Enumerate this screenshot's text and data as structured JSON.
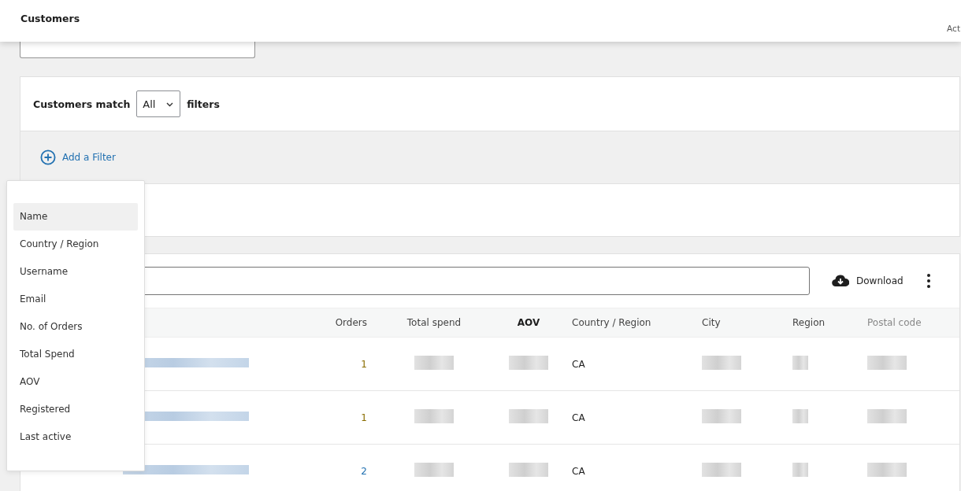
{
  "header": {
    "title": "Customers",
    "account_caption": "Act"
  },
  "filters": {
    "match_label": "Customers match",
    "match_value": "All",
    "match_suffix": "filters",
    "add_filter": "Add a Filter"
  },
  "filter_menu": {
    "items": [
      {
        "label": "Name",
        "selected": true
      },
      {
        "label": "Country / Region",
        "selected": false
      },
      {
        "label": "Username",
        "selected": false
      },
      {
        "label": "Email",
        "selected": false
      },
      {
        "label": "No. of Orders",
        "selected": false
      },
      {
        "label": "Total Spend",
        "selected": false
      },
      {
        "label": "AOV",
        "selected": false
      },
      {
        "label": "Registered",
        "selected": false
      },
      {
        "label": "Last active",
        "selected": false
      }
    ]
  },
  "toolbar": {
    "download": "Download"
  },
  "table": {
    "columns": [
      {
        "label": "Orders",
        "bold": false
      },
      {
        "label": "Total spend",
        "bold": false
      },
      {
        "label": "AOV",
        "bold": true
      },
      {
        "label": "Country / Region",
        "bold": false
      },
      {
        "label": "City",
        "bold": false
      },
      {
        "label": "Region",
        "bold": false
      },
      {
        "label": "Postal code",
        "bold": false
      }
    ],
    "rows": [
      {
        "orders": "1",
        "orders_link": false,
        "country": "CA"
      },
      {
        "orders": "1",
        "orders_link": false,
        "country": "CA"
      },
      {
        "orders": "2",
        "orders_link": true,
        "country": "CA"
      }
    ]
  }
}
